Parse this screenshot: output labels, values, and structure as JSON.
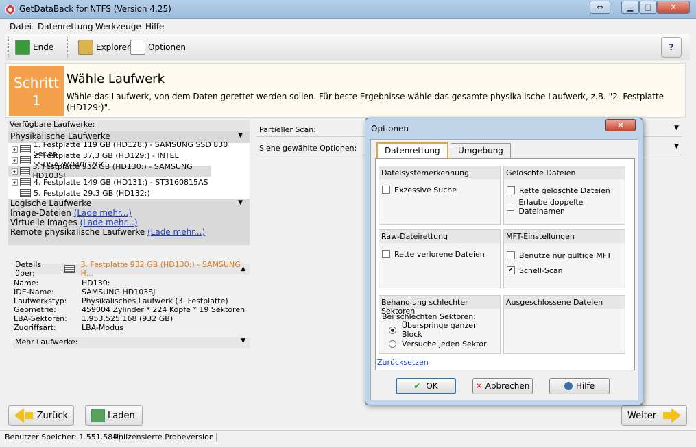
{
  "window": {
    "title": "GetDataBack for NTFS (Version 4.25)"
  },
  "titlebar_buttons": {
    "restore": "⇔",
    "minimize": "▁",
    "maximize": "□",
    "close": "✕"
  },
  "menu": [
    "Datei",
    "Datenrettung",
    "Werkzeuge",
    "Hilfe"
  ],
  "toolbar": {
    "end": "Ende",
    "explorer": "Explorer",
    "options": "Optionen",
    "help": "?"
  },
  "step": {
    "label": "Schritt",
    "number": "1",
    "title": "Wähle Laufwerk",
    "description": "Wähle das Laufwerk, von dem Daten gerettet werden sollen. Für beste Ergebnisse wähle das gesamte physikalische Laufwerk, z.B. \"2. Festplatte (HD129:)\"."
  },
  "drives": {
    "label": "Verfügbare Laufwerke:",
    "physical_header": "Physikalische Laufwerke",
    "items": [
      "1. Festplatte 119 GB (HD128:) - SAMSUNG SSD 830 Series",
      "2. Festplatte 37,3 GB (HD129:) - INTEL SSDSA2M040G2GC",
      "3. Festplatte 932 GB (HD130:) - SAMSUNG HD103SJ",
      "4. Festplatte 149 GB (HD131:) - ST3160815AS",
      "5. Festplatte 29,3 GB (HD132:)"
    ],
    "logical_header": "Logische Laufwerke",
    "image_label": "Image-Dateien",
    "virtual_label": "Virtuelle Images",
    "remote_label": "Remote physikalische Laufwerke",
    "load_more": "(Lade mehr...)"
  },
  "details": {
    "label": "Details über:",
    "selected": "3. Festplatte 932 GB (HD130:) - SAMSUNG H...",
    "rows": [
      {
        "k": "Name:",
        "v": "HD130:"
      },
      {
        "k": "IDE-Name:",
        "v": "SAMSUNG HD103SJ"
      },
      {
        "k": "Laufwerkstyp:",
        "v": "Physikalisches Laufwerk (3. Festplatte)"
      },
      {
        "k": "Geometrie:",
        "v": "459004 Zylinder * 224 Köpfe * 19 Sektoren"
      },
      {
        "k": "LBA-Sektoren:",
        "v": "1.953.525.168 (932 GB)"
      },
      {
        "k": "Zugriffsart:",
        "v": "LBA-Modus"
      }
    ],
    "more": "Mehr Laufwerke:"
  },
  "right": {
    "partial_scan": "Partieller Scan:",
    "see_options": "Siehe gewählte Optionen:"
  },
  "nav": {
    "back": "Zurück",
    "load": "Laden",
    "next": "Weiter"
  },
  "status": {
    "memory": "Benutzer Speicher: 1.551.584",
    "license": "Unlizensierte Probeversion"
  },
  "dialog": {
    "title": "Optionen",
    "close": "✕",
    "tabs": [
      "Datenrettung",
      "Umgebung"
    ],
    "groups": {
      "fs": {
        "title": "Dateisystemerkennung",
        "opt1": "Exzessive Suche"
      },
      "deleted": {
        "title": "Gelöschte Dateien",
        "opt1": "Rette gelöschte Dateien",
        "opt2": "Erlaube doppelte Dateinamen"
      },
      "raw": {
        "title": "Raw-Dateirettung",
        "opt1": "Rette verlorene Dateien"
      },
      "mft": {
        "title": "MFT-Einstellungen",
        "opt1": "Benutze nur gültige MFT",
        "opt2": "Schell-Scan"
      },
      "bad": {
        "title": "Behandlung schlechter Sektoren",
        "sub": "Bei schlechten Sektoren:",
        "r1": "Überspringe ganzen Block",
        "r2": "Versuche jeden Sektor"
      },
      "excl": {
        "title": "Ausgeschlossene Dateien"
      }
    },
    "reset": "Zurücksetzen",
    "ok": "OK",
    "cancel": "Abbrechen",
    "help": "Hilfe",
    "check": "✔"
  }
}
